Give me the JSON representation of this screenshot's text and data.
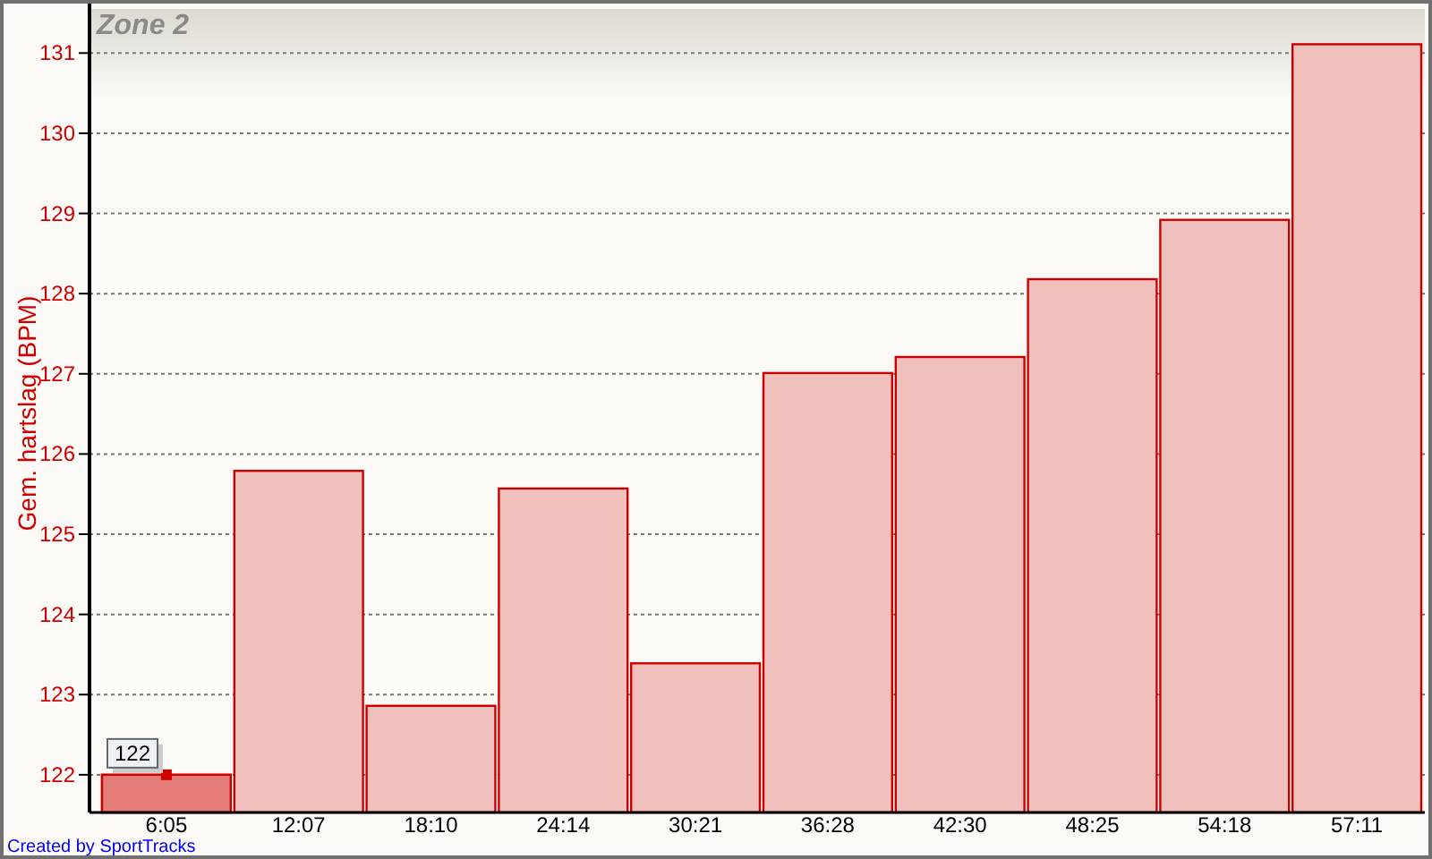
{
  "chart_data": {
    "type": "bar",
    "title": "Zone 2",
    "grid": true,
    "categories": [
      "6:05",
      "12:07",
      "18:10",
      "24:14",
      "30:21",
      "36:28",
      "42:30",
      "48:25",
      "54:18",
      "57:11"
    ],
    "ylabel": "Gem. hartslag (BPM)",
    "series": [
      {
        "color": "#f0c0bc",
        "values": [
          122.0,
          125.79,
          122.86,
          125.57,
          123.39,
          127.01,
          127.21,
          128.18,
          128.92,
          131.11
        ]
      }
    ],
    "ylim": [
      121.53,
      131.55
    ],
    "yticks": [
      122,
      123,
      124,
      125,
      126,
      127,
      128,
      129,
      130,
      131
    ]
  },
  "bars": [
    {
      "selected": true,
      "tooltip": "122"
    },
    {
      "selected": false
    },
    {
      "selected": false
    },
    {
      "selected": false
    },
    {
      "selected": false
    },
    {
      "selected": false
    },
    {
      "selected": false
    },
    {
      "selected": false
    },
    {
      "selected": false
    },
    {
      "selected": false
    }
  ],
  "credit": "Created by SportTracks"
}
